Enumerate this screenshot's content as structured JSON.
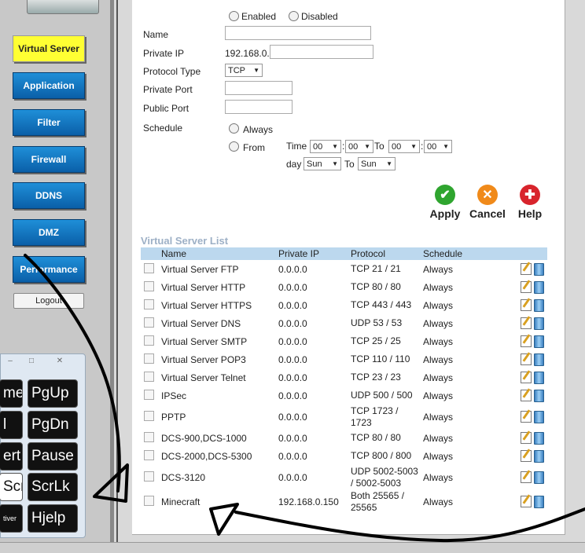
{
  "sidebar": {
    "nav": [
      {
        "label": "Virtual Server",
        "active": true
      },
      {
        "label": "Application",
        "active": false
      },
      {
        "label": "Filter",
        "active": false
      },
      {
        "label": "Firewall",
        "active": false
      },
      {
        "label": "DDNS",
        "active": false
      },
      {
        "label": "DMZ",
        "active": false
      },
      {
        "label": "Performance",
        "active": false
      }
    ],
    "logout_label": "Logout"
  },
  "keyboard": {
    "controls": [
      "–",
      "□",
      "✕"
    ],
    "keys": [
      {
        "label": "me",
        "selected": false
      },
      {
        "label": "PgUp",
        "selected": false
      },
      {
        "label": "l",
        "selected": false
      },
      {
        "label": "PgDn",
        "selected": false
      },
      {
        "label": "ert",
        "selected": false
      },
      {
        "label": "Pause",
        "selected": false
      },
      {
        "label": "Scn",
        "selected": true
      },
      {
        "label": "ScrLk",
        "selected": false
      },
      {
        "label": "tiver",
        "selected": false
      },
      {
        "label": "Hjelp",
        "selected": false
      }
    ]
  },
  "form": {
    "enabled_label": "Enabled",
    "disabled_label": "Disabled",
    "name_label": "Name",
    "name_value": "",
    "private_ip_label": "Private IP",
    "private_ip_prefix": "192.168.0.",
    "private_ip_value": "",
    "protocol_label": "Protocol Type",
    "protocol_value": "TCP",
    "private_port_label": "Private Port",
    "private_port_value": "",
    "public_port_label": "Public Port",
    "public_port_value": "",
    "schedule_label": "Schedule",
    "always_label": "Always",
    "from_label": "From",
    "time_label": "Time",
    "to_label": "To",
    "day_label": "day",
    "time_from_hour": "00",
    "time_from_min": "00",
    "time_to_hour": "00",
    "time_to_min": "00",
    "colon": ":",
    "day_from": "Sun",
    "day_to": "Sun"
  },
  "actions": {
    "apply": "Apply",
    "cancel": "Cancel",
    "help": "Help",
    "apply_color": "#2fa52f",
    "cancel_color": "#f08a1a",
    "help_color": "#d8242c"
  },
  "list": {
    "title": "Virtual Server List",
    "columns": [
      "Name",
      "Private IP",
      "Protocol",
      "Schedule"
    ],
    "rows": [
      {
        "name": "Virtual Server FTP",
        "ip": "0.0.0.0",
        "protocol": "TCP 21 / 21",
        "schedule": "Always"
      },
      {
        "name": "Virtual Server HTTP",
        "ip": "0.0.0.0",
        "protocol": "TCP 80 / 80",
        "schedule": "Always"
      },
      {
        "name": "Virtual Server HTTPS",
        "ip": "0.0.0.0",
        "protocol": "TCP 443 / 443",
        "schedule": "Always"
      },
      {
        "name": "Virtual Server DNS",
        "ip": "0.0.0.0",
        "protocol": "UDP 53 / 53",
        "schedule": "Always"
      },
      {
        "name": "Virtual Server SMTP",
        "ip": "0.0.0.0",
        "protocol": "TCP 25 / 25",
        "schedule": "Always"
      },
      {
        "name": "Virtual Server POP3",
        "ip": "0.0.0.0",
        "protocol": "TCP 110 / 110",
        "schedule": "Always"
      },
      {
        "name": "Virtual Server Telnet",
        "ip": "0.0.0.0",
        "protocol": "TCP 23 / 23",
        "schedule": "Always"
      },
      {
        "name": "IPSec",
        "ip": "0.0.0.0",
        "protocol": "UDP 500 / 500",
        "schedule": "Always"
      },
      {
        "name": "PPTP",
        "ip": "0.0.0.0",
        "protocol": "TCP 1723 / 1723",
        "schedule": "Always"
      },
      {
        "name": "DCS-900,DCS-1000",
        "ip": "0.0.0.0",
        "protocol": "TCP 80 / 80",
        "schedule": "Always"
      },
      {
        "name": "DCS-2000,DCS-5300",
        "ip": "0.0.0.0",
        "protocol": "TCP 800 / 800",
        "schedule": "Always"
      },
      {
        "name": "DCS-3120",
        "ip": "0.0.0.0",
        "protocol": "UDP 5002-5003 / 5002-5003",
        "schedule": "Always"
      },
      {
        "name": "Minecraft",
        "ip": "192.168.0.150",
        "protocol": "Both 25565 / 25565",
        "schedule": "Always"
      }
    ]
  }
}
